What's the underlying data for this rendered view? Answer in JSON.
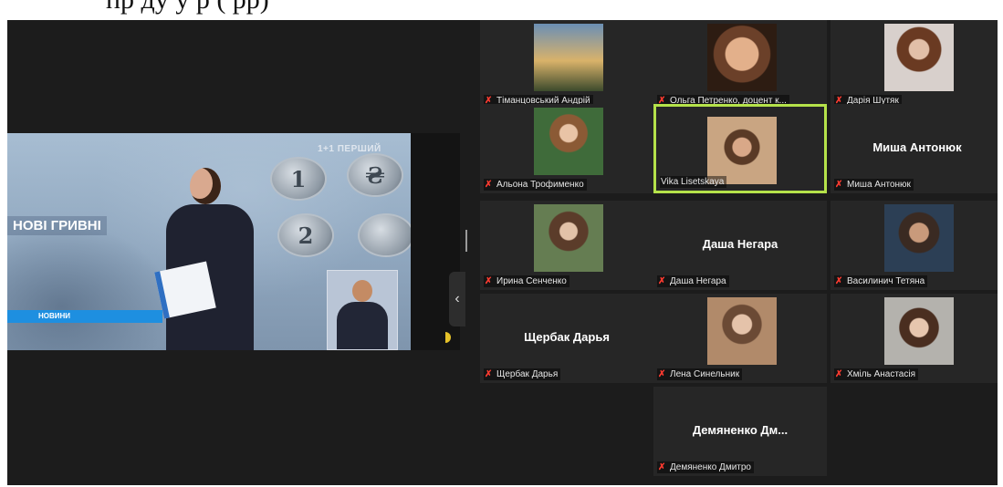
{
  "caption": "пр                       ду                                 у                         р     (               рр)",
  "share": {
    "headline": "НОВІ ГРИВНІ",
    "ticker": "НОВИНИ",
    "logo": "1+1 ПЕРШИЙ",
    "coins": [
      "1",
      "₴",
      "2",
      ""
    ],
    "collapse_glyph": "‹"
  },
  "participants": [
    {
      "name": "Тіманцовський Андрій",
      "muted": true,
      "video": true,
      "active": false
    },
    {
      "name": "Ольга Петренко, доцент к...",
      "muted": true,
      "video": true,
      "active": false
    },
    {
      "name": "Дарія Шутяк",
      "muted": true,
      "video": true,
      "active": false
    },
    {
      "name": "Альона Трофименко",
      "muted": true,
      "video": true,
      "active": false
    },
    {
      "name": "Vika Lisetskaya",
      "muted": false,
      "video": true,
      "active": true
    },
    {
      "name": "Миша Антонюк",
      "muted": true,
      "video": false,
      "active": false,
      "display": "Миша Антонюк"
    },
    {
      "name": "Ирина Сенченко",
      "muted": true,
      "video": true,
      "active": false
    },
    {
      "name": "Даша Негара",
      "muted": true,
      "video": false,
      "active": false,
      "display": "Даша Негара"
    },
    {
      "name": "Василинич Тетяна",
      "muted": true,
      "video": true,
      "active": false
    },
    {
      "name": "Щербак Дарья",
      "muted": true,
      "video": false,
      "active": false,
      "display": "Щербак Дарья"
    },
    {
      "name": "Лена Синельник",
      "muted": true,
      "video": true,
      "active": false
    },
    {
      "name": "Хміль Анастасія",
      "muted": true,
      "video": true,
      "active": false
    },
    {
      "name": "Демяненко Дмитро",
      "muted": true,
      "video": false,
      "active": false,
      "display": "Демяненко Дм..."
    }
  ],
  "icons": {
    "mic_muted": "mic-muted-icon"
  },
  "colors": {
    "active_border": "#b5e24a",
    "muted_mic": "#ff3b30",
    "background": "#1c1c1c",
    "tile": "#262626"
  }
}
